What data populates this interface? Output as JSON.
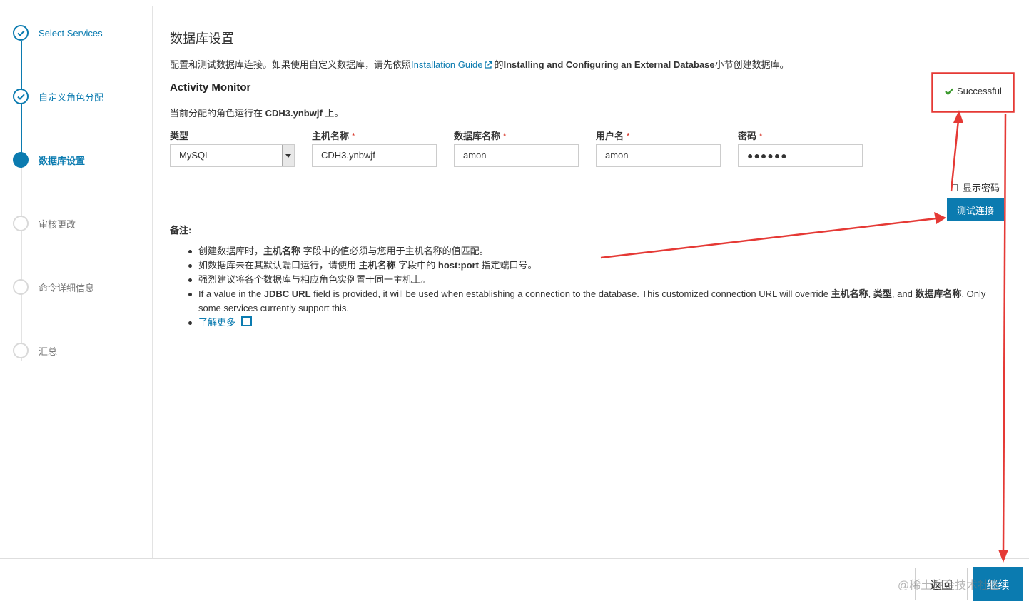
{
  "sidebar": {
    "steps": [
      {
        "label": "Select Services",
        "state": "done"
      },
      {
        "label": "自定义角色分配",
        "state": "done"
      },
      {
        "label": "数据库设置",
        "state": "active"
      },
      {
        "label": "审核更改",
        "state": "pending"
      },
      {
        "label": "命令详细信息",
        "state": "pending"
      },
      {
        "label": "汇总",
        "state": "pending"
      }
    ]
  },
  "main": {
    "title": "数据库设置",
    "intro": {
      "before": "配置和测试数据库连接。如果使用自定义数据库，请先依照",
      "link": "Installation Guide",
      "mid": "的",
      "bold": "Installing and Configuring an External Database",
      "after": "小节创建数据库。"
    },
    "section_title": "Activity Monitor",
    "assigned": {
      "prefix": "当前分配的角色运行在 ",
      "host": "CDH3.ynbwjf",
      "suffix": " 上。"
    },
    "fields": {
      "type": {
        "label": "类型",
        "value": "MySQL"
      },
      "host": {
        "label": "主机名称",
        "value": "CDH3.ynbwjf"
      },
      "db_name": {
        "label": "数据库名称",
        "value": "amon"
      },
      "username": {
        "label": "用户名",
        "value": "amon"
      },
      "password": {
        "label": "密码",
        "value": "●●●●●●"
      }
    },
    "required_mark": "*",
    "status": "Successful",
    "show_password": "显示密码",
    "test_button": "测试连接",
    "notes_title": "备注:",
    "notes": {
      "n1": {
        "a": "创建数据库时，",
        "b": "主机名称",
        "c": " 字段中的值必须与您用于主机名称的值匹配。"
      },
      "n2": {
        "a": "如数据库未在其默认端口运行，请使用 ",
        "b": "主机名称",
        "c": " 字段中的 ",
        "d": "host:port",
        "e": " 指定端口号。"
      },
      "n3": {
        "a": "强烈建议将各个数据库与相应角色实例置于同一主机上。"
      },
      "n4": {
        "a": "If a value in the ",
        "b": "JDBC URL",
        "c": " field is provided, it will be used when establishing a connection to the database. This customized connection URL will override ",
        "d": "主机名称",
        "e": ", ",
        "f": "类型",
        "g": ", and ",
        "h": "数据库名称",
        "i": ". Only some services currently support this."
      },
      "learn_more": "了解更多"
    }
  },
  "footer": {
    "back": "返回",
    "continue": "继续",
    "watermark": "@稀土掘金技术社区"
  },
  "colors": {
    "accent": "#0b7bb0",
    "annotation": "#e53935",
    "success_check": "#3c9a2e",
    "required": "#d62d20"
  }
}
